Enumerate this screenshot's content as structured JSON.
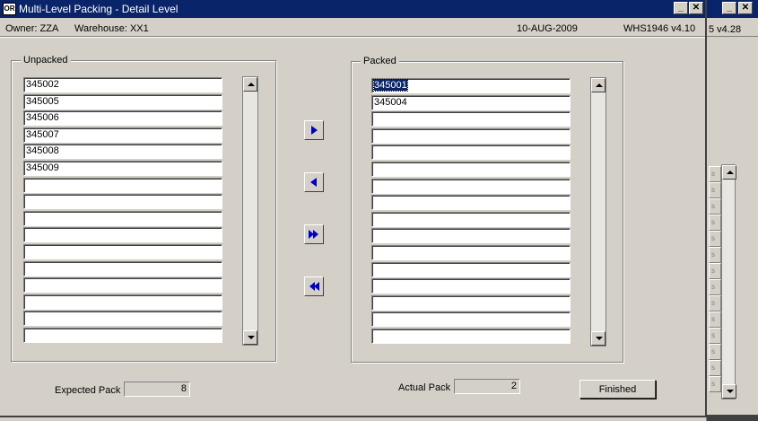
{
  "window": {
    "title": "Multi-Level Packing - Detail Level",
    "icon_glyph": "OR",
    "minimize_glyph": "_",
    "close_glyph": "✕"
  },
  "background_window": {
    "version": "5 v4.28",
    "minimize_glyph": "_",
    "close_glyph": "✕"
  },
  "info_bar": {
    "owner": "Owner:  ZZA",
    "warehouse": "Warehouse:  XX1",
    "date": "10-AUG-2009",
    "version": "WHS1946  v4.10"
  },
  "unpacked": {
    "label": "Unpacked",
    "items": [
      "345002",
      "345005",
      "345006",
      "345007",
      "345008",
      "345009",
      "",
      "",
      "",
      "",
      "",
      "",
      "",
      "",
      "",
      ""
    ]
  },
  "packed": {
    "label": "Packed",
    "items": [
      "345001",
      "345004",
      "",
      "",
      "",
      "",
      "",
      "",
      "",
      "",
      "",
      "",
      "",
      "",
      "",
      ""
    ]
  },
  "move_buttons": [
    {
      "name": "move-right-button",
      "icon": "arrow-right-icon"
    },
    {
      "name": "move-left-button",
      "icon": "arrow-left-icon"
    },
    {
      "name": "move-all-right-button",
      "icon": "double-arrow-right-icon"
    },
    {
      "name": "move-all-left-button",
      "icon": "double-arrow-left-icon"
    }
  ],
  "footer": {
    "expected_pack_label": "Expected Pack",
    "expected_pack_value": "8",
    "actual_pack_label": "Actual Pack",
    "actual_pack_value": "2",
    "finished_label": "Finished"
  },
  "colors": {
    "titlebar": "#0a246a",
    "face": "#d4d0c8",
    "arrow": "#0000c0"
  }
}
